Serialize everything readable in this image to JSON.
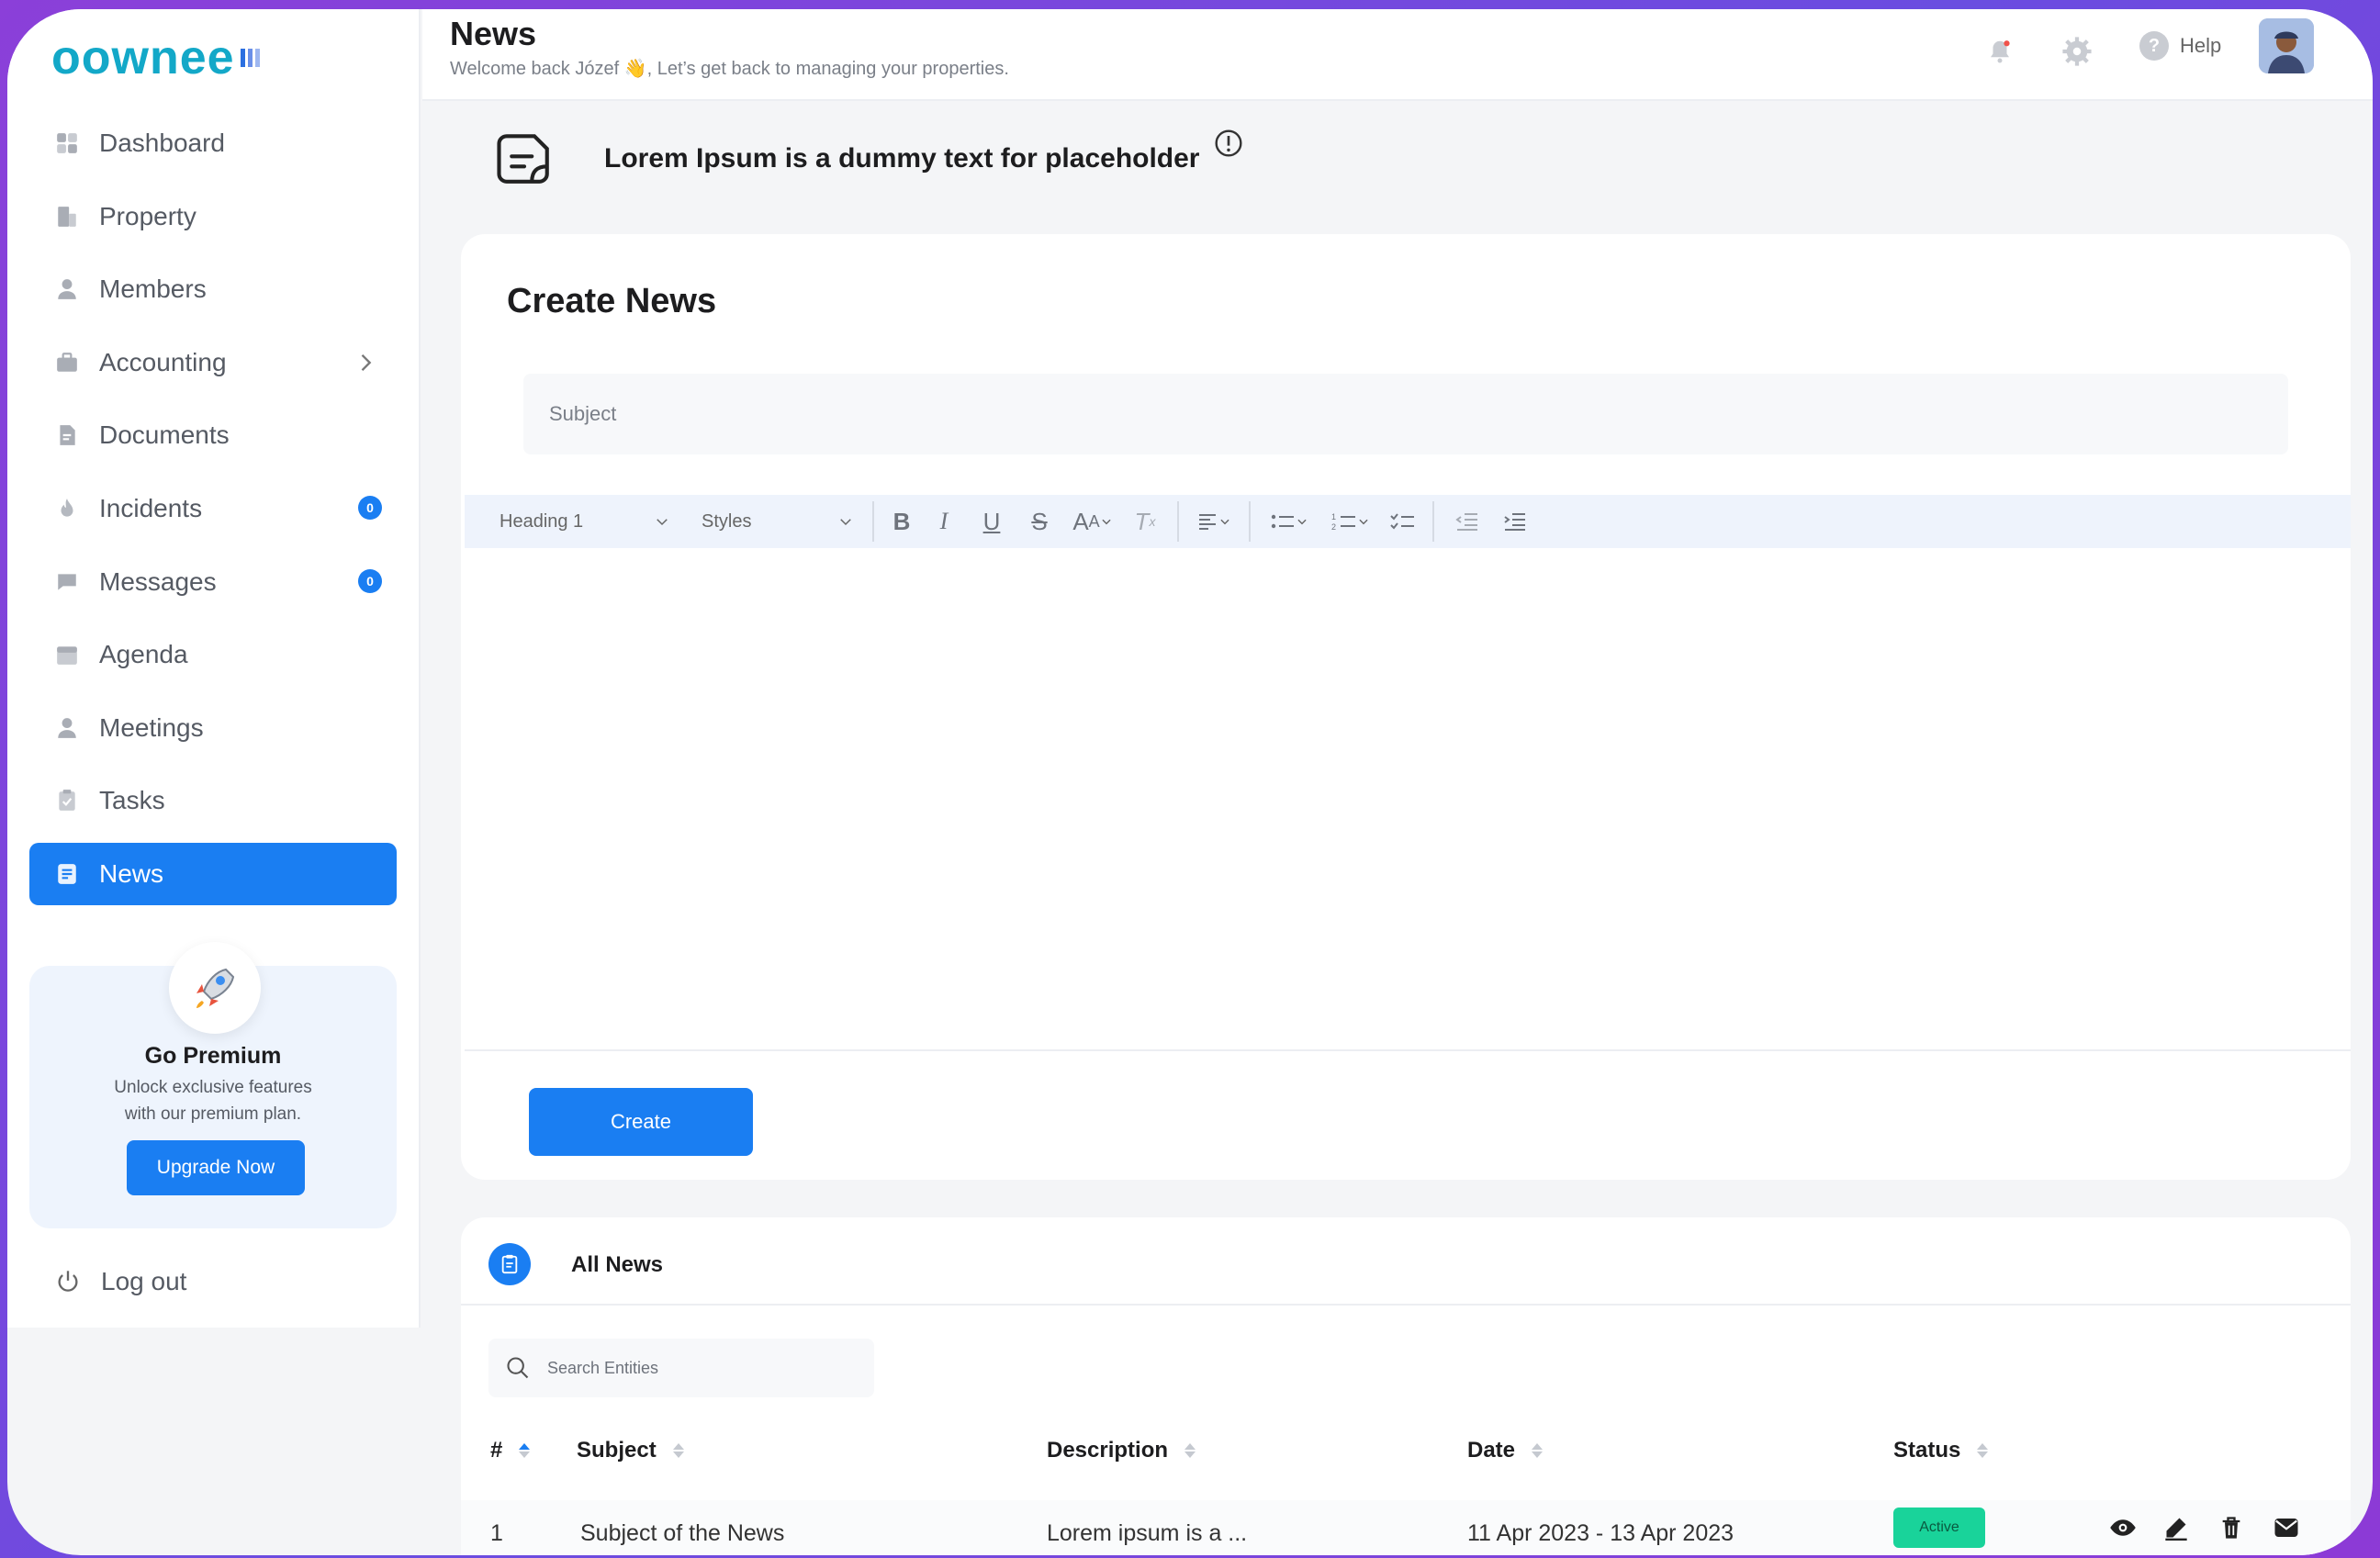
{
  "brand": {
    "logo_text": "oownee"
  },
  "colors": {
    "accent": "#1a7ef2",
    "status_active": "#19d39a",
    "frame_border": "#8b3fd9"
  },
  "sidebar": {
    "items": [
      {
        "label": "Dashboard",
        "icon": "dashboard-icon"
      },
      {
        "label": "Property",
        "icon": "building-icon"
      },
      {
        "label": "Members",
        "icon": "user-icon"
      },
      {
        "label": "Accounting",
        "icon": "briefcase-icon",
        "has_chevron": true
      },
      {
        "label": "Documents",
        "icon": "document-icon"
      },
      {
        "label": "Incidents",
        "icon": "flame-icon",
        "badge": "0"
      },
      {
        "label": "Messages",
        "icon": "chat-icon",
        "badge": "0"
      },
      {
        "label": "Agenda",
        "icon": "calendar-icon"
      },
      {
        "label": "Meetings",
        "icon": "user-icon"
      },
      {
        "label": "Tasks",
        "icon": "clipboard-icon"
      },
      {
        "label": "News",
        "icon": "news-icon",
        "active": true
      }
    ],
    "premium": {
      "title": "Go Premium",
      "line1": "Unlock exclusive features",
      "line2": "with our premium plan.",
      "button": "Upgrade Now"
    },
    "logout": "Log out"
  },
  "header": {
    "title": "News",
    "subtitle": "Welcome back Józef 👋, Let’s get back to managing your properties.",
    "help": "Help"
  },
  "banner": {
    "text": "Lorem Ipsum is a dummy text for placeholder"
  },
  "create": {
    "title": "Create News",
    "subject_placeholder": "Subject",
    "toolbar": {
      "heading": "Heading 1",
      "styles": "Styles"
    },
    "button": "Create"
  },
  "list": {
    "title": "All News",
    "search_placeholder": "Search Entities",
    "columns": [
      "#",
      "Subject",
      "Description",
      "Date",
      "Status"
    ],
    "rows": [
      {
        "num": "1",
        "subject": "Subject of the News",
        "description": "Lorem ipsum is a ...",
        "date": "11 Apr 2023 - 13 Apr 2023",
        "status": "Active"
      }
    ]
  }
}
